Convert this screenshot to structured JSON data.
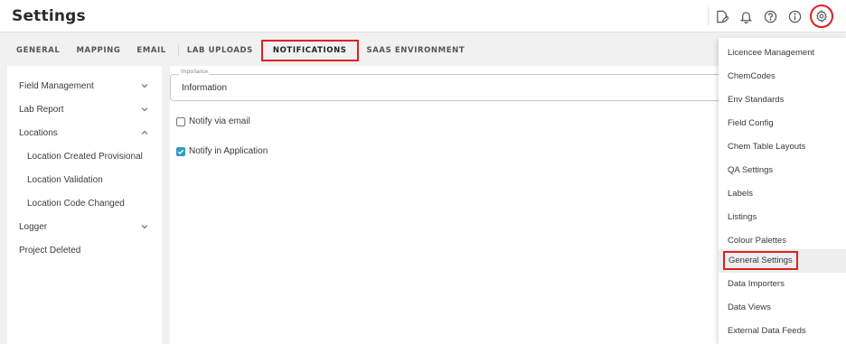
{
  "header": {
    "title": "Settings",
    "icons": [
      "edit-document-icon",
      "bell-icon",
      "help-icon",
      "info-icon",
      "gear-icon"
    ]
  },
  "tabs": [
    {
      "label": "GENERAL",
      "active": false
    },
    {
      "label": "MAPPING",
      "active": false
    },
    {
      "label": "EMAIL",
      "active": false
    },
    {
      "label": "LAB UPLOADS",
      "active": false
    },
    {
      "label": "NOTIFICATIONS",
      "active": true
    },
    {
      "label": "SAAS ENVIRONMENT",
      "active": false
    }
  ],
  "sidebar": {
    "items": [
      {
        "label": "Field Management",
        "chevron": "down"
      },
      {
        "label": "Lab Report",
        "chevron": "down"
      },
      {
        "label": "Locations",
        "chevron": "up"
      },
      {
        "label": "Location Created Provisional",
        "sub": true
      },
      {
        "label": "Location Validation",
        "sub": true
      },
      {
        "label": "Location Code Changed",
        "sub": true
      },
      {
        "label": "Logger",
        "chevron": "down"
      },
      {
        "label": "Project Deleted"
      }
    ]
  },
  "main": {
    "importance": {
      "legend": "Importance",
      "value": "Information"
    },
    "notify_email": {
      "label": "Notify via email",
      "checked": false
    },
    "notify_app": {
      "label": "Notify in Application",
      "checked": true
    }
  },
  "menu": {
    "items": [
      {
        "label": "Licencee Management"
      },
      {
        "label": "ChemCodes"
      },
      {
        "label": "Env Standards"
      },
      {
        "label": "Field Config"
      },
      {
        "label": "Chem Table Layouts"
      },
      {
        "label": "QA Settings"
      },
      {
        "label": "Labels"
      },
      {
        "label": "Listings"
      },
      {
        "label": "Colour Palettes"
      },
      {
        "label": "General Settings",
        "highlighted": true
      },
      {
        "label": "Data Importers"
      },
      {
        "label": "Data Views"
      },
      {
        "label": "External Data Feeds"
      }
    ]
  },
  "colors": {
    "highlight_border": "#e02020",
    "checkbox_checked": "#2f9cc4"
  }
}
